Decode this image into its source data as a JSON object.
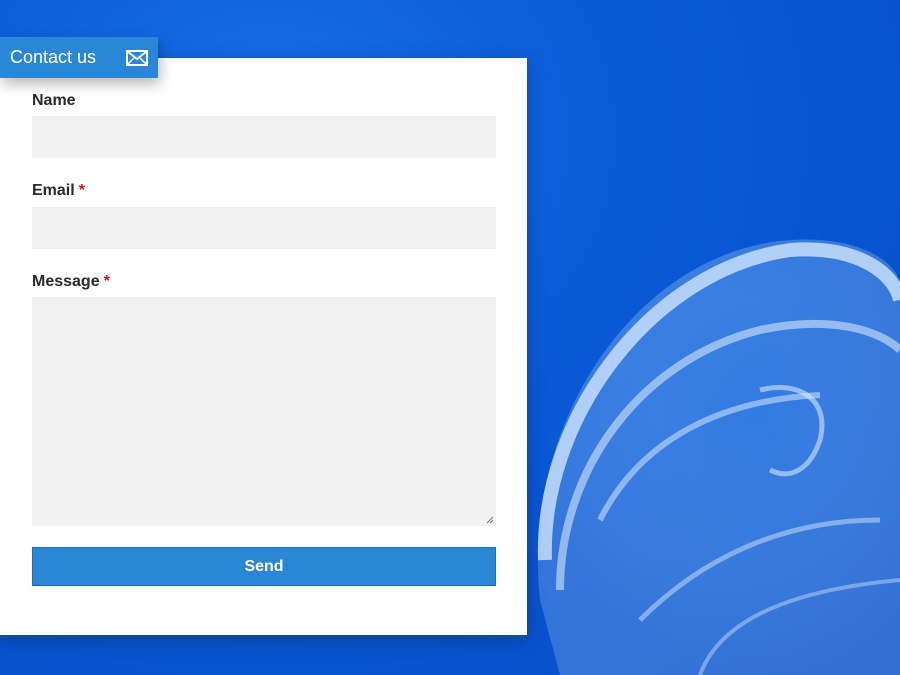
{
  "tab": {
    "label": "Contact us",
    "icon": "envelope-icon"
  },
  "form": {
    "name_label": "Name",
    "email_label": "Email",
    "message_label": "Message",
    "required_mark": "*",
    "send_label": "Send"
  },
  "colors": {
    "accent": "#2a86d6",
    "required": "#dd1111",
    "input_bg": "#f1f1f1",
    "background": "#0a5ad8"
  }
}
